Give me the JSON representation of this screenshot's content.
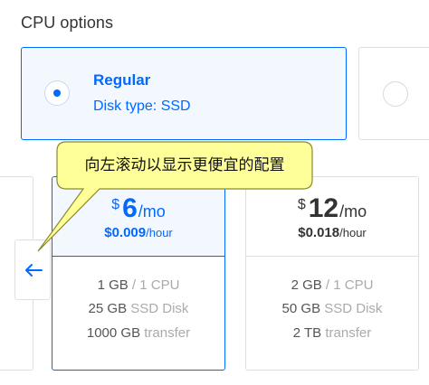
{
  "section_title": "CPU options",
  "cpu_options": [
    {
      "name": "Regular",
      "sub": "Disk type: SSD",
      "selected": true
    },
    {
      "name": "",
      "sub": "",
      "selected": false
    }
  ],
  "tooltip": {
    "text": "向左滚动以显示更便宜的配置",
    "background": "#ffff99"
  },
  "plans": [
    {
      "currency": "$",
      "amount": "6",
      "period": "/mo",
      "hourly_value": "$0.009",
      "hourly_unit": "/hour",
      "ram": "1 GB",
      "cpu": "/ 1 CPU",
      "disk": "25 GB",
      "disk_type": "SSD Disk",
      "transfer": "1000 GB",
      "transfer_label": "transfer",
      "selected": true
    },
    {
      "currency": "$",
      "amount": "12",
      "period": "/mo",
      "hourly_value": "$0.018",
      "hourly_unit": "/hour",
      "ram": "2 GB",
      "cpu": "/ 1 CPU",
      "disk": "50 GB",
      "disk_type": "SSD Disk",
      "transfer": "2 TB",
      "transfer_label": "transfer",
      "selected": false
    }
  ],
  "scroll_left_icon": "arrow-left-icon",
  "colors": {
    "accent": "#0069ff",
    "selected_bg": "#f3f8ff",
    "border": "#dfdfdf",
    "text": "#333333",
    "muted": "#aaaaaa"
  }
}
